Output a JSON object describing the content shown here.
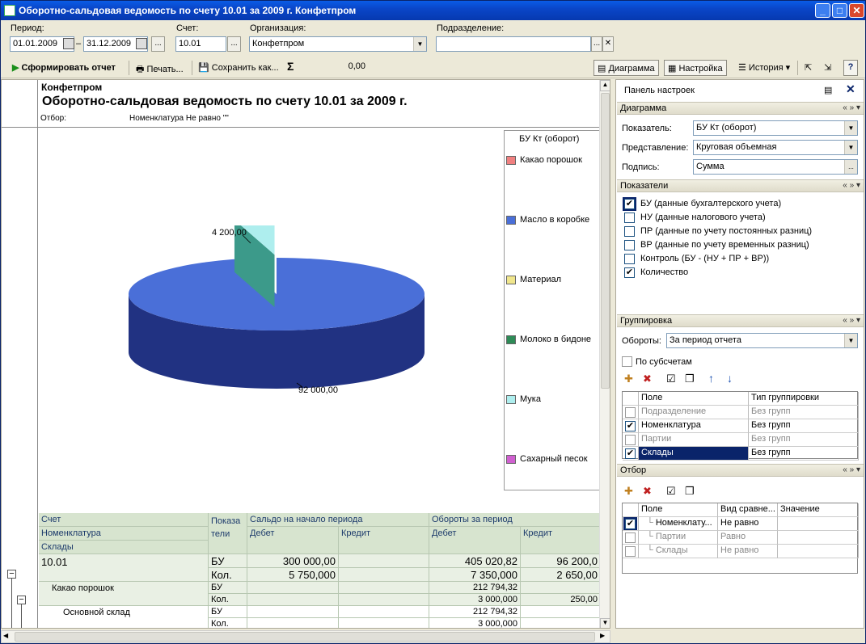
{
  "window": {
    "title": "Оборотно-сальдовая ведомость по счету 10.01 за 2009 г. Конфетпром"
  },
  "filters": {
    "period_label": "Период:",
    "date_from": "01.01.2009",
    "date_to": "31.12.2009",
    "dash": "–",
    "account_label": "Счет:",
    "account": "10.01",
    "org_label": "Организация:",
    "org": "Конфетпром",
    "dept_label": "Подразделение:",
    "dept": "",
    "ellipsis": "...",
    "x": "✕"
  },
  "toolbar": {
    "generate": "Сформировать отчет",
    "print": "Печать...",
    "save": "Сохранить как...",
    "sigma": "Σ",
    "sum": "0,00",
    "chart": "Диаграмма",
    "settings": "Настройка",
    "history": "История",
    "help": "?"
  },
  "report": {
    "company": "Конфетпром",
    "title": "Оборотно-сальдовая ведомость по счету 10.01 за 2009 г.",
    "filter_label": "Отбор:",
    "filter_value": "Номенклатура Не равно \"\""
  },
  "chart_data": {
    "type": "pie",
    "style": "3d",
    "legend_title": "БУ Кт (оборот)",
    "legend_placement": "right",
    "categories": [
      "Какао порошок",
      "Масло в коробке",
      "Материал",
      "Молоко в бидоне",
      "Мука",
      "Сахарный песок"
    ],
    "colors": [
      "#f08080",
      "#4a6fd8",
      "#f0e68c",
      "#2e8b57",
      "#aeeeee",
      "#d060d0"
    ],
    "slices": [
      {
        "name": "Масло в коробке",
        "value": 92000.0,
        "label": "92 000,00"
      },
      {
        "name": "Мука",
        "value": 4200.0,
        "label": "4 200,00"
      }
    ]
  },
  "grid": {
    "headers": {
      "account": "Счет",
      "nomenclature": "Номенклатура",
      "warehouses": "Склады",
      "indicator": "Показа\nтели",
      "opening": "Сальдо на начало периода",
      "turnover": "Обороты за период",
      "debit": "Дебет",
      "credit": "Кредит"
    },
    "rows": [
      {
        "name": "10.01",
        "bu": "БУ",
        "kol": "Кол.",
        "od_bu": "300 000,00",
        "od_kol": "5 750,000",
        "oc_bu": "",
        "oc_kol": "",
        "td_bu": "405 020,82",
        "td_kol": "7 350,000",
        "tc_bu": "96 200,0",
        "tc_kol": "2 650,00"
      },
      {
        "name": "Какао порошок",
        "bu": "БУ",
        "kol": "Кол.",
        "od_bu": "",
        "od_kol": "",
        "oc_bu": "",
        "oc_kol": "",
        "td_bu": "212 794,32",
        "td_kol": "3 000,000",
        "tc_bu": "",
        "tc_kol": "250,00"
      },
      {
        "name": "Основной склад",
        "bu": "БУ",
        "kol": "Кол.",
        "od_bu": "",
        "od_kol": "",
        "oc_bu": "",
        "oc_kol": "",
        "td_bu": "212 794,32",
        "td_kol": "3 000,000",
        "tc_bu": "",
        "tc_kol": ""
      }
    ]
  },
  "panel": {
    "title": "Панель настроек",
    "diagram": {
      "header": "Диаграмма",
      "indicator_label": "Показатель:",
      "indicator": "БУ Кт (оборот)",
      "view_label": "Представление:",
      "view": "Круговая объемная",
      "caption_label": "Подпись:",
      "caption": "Сумма"
    },
    "indicators": {
      "header": "Показатели",
      "items": [
        {
          "label": "БУ (данные бухгалтерского учета)",
          "checked": true
        },
        {
          "label": "НУ (данные налогового учета)",
          "checked": false
        },
        {
          "label": "ПР (данные по учету постоянных разниц)",
          "checked": false
        },
        {
          "label": "ВР (данные по учету временных разниц)",
          "checked": false
        },
        {
          "label": "Контроль (БУ - (НУ + ПР + ВР))",
          "checked": false
        },
        {
          "label": "Количество",
          "checked": true
        }
      ]
    },
    "grouping": {
      "header": "Группировка",
      "turnover_label": "Обороты:",
      "turnover": "За период отчета",
      "subaccounts": "По субсчетам",
      "col_field": "Поле",
      "col_type": "Тип группировки",
      "rows": [
        {
          "field": "Подразделение",
          "type": "Без групп",
          "checked": false
        },
        {
          "field": "Номенклатура",
          "type": "Без групп",
          "checked": true
        },
        {
          "field": "Партии",
          "type": "Без групп",
          "checked": false
        },
        {
          "field": "Склады",
          "type": "Без групп",
          "checked": true
        }
      ]
    },
    "selection": {
      "header": "Отбор",
      "col_field": "Поле",
      "col_cmp": "Вид сравне...",
      "col_value": "Значение",
      "rows": [
        {
          "field": "Номенклату...",
          "cmp": "Не равно",
          "checked": true
        },
        {
          "field": "Партии",
          "cmp": "Равно",
          "checked": false
        },
        {
          "field": "Склады",
          "cmp": "Не равно",
          "checked": false
        }
      ]
    }
  }
}
